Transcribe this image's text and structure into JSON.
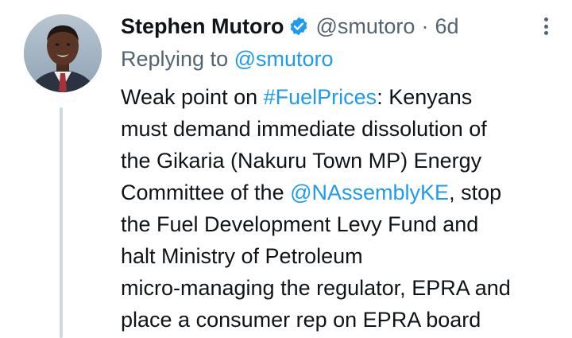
{
  "author": {
    "name": "Stephen Mutoro",
    "handle": "@smutoro",
    "separator": "·",
    "time": "6d",
    "verified": true,
    "avatar_icon": "profile-photo"
  },
  "reply": {
    "prefix": "Replying to",
    "to_handle": "@smutoro"
  },
  "tweet": {
    "lines": [
      {
        "segments": [
          {
            "text": "Weak point on ",
            "link": false
          },
          {
            "text": "#FuelPrices",
            "link": true
          },
          {
            "text": ": Kenyans",
            "link": false
          }
        ]
      },
      {
        "segments": [
          {
            "text": "must demand immediate dissolution of",
            "link": false
          }
        ]
      },
      {
        "segments": [
          {
            "text": "the Gikaria (Nakuru Town MP) Energy",
            "link": false
          }
        ]
      },
      {
        "segments": [
          {
            "text": "Committee of the ",
            "link": false
          },
          {
            "text": "@NAssemblyKE",
            "link": true
          },
          {
            "text": ", stop",
            "link": false
          }
        ]
      },
      {
        "segments": [
          {
            "text": "the Fuel Development Levy Fund and",
            "link": false
          }
        ]
      },
      {
        "segments": [
          {
            "text": "halt Ministry of Petroleum",
            "link": false
          }
        ]
      },
      {
        "segments": [
          {
            "text": "micro-managing the regulator, EPRA and",
            "link": false
          }
        ]
      },
      {
        "segments": [
          {
            "text": "place a consumer rep on EPRA board",
            "link": false
          }
        ]
      }
    ]
  },
  "colors": {
    "link": "#1d9bf0",
    "secondary_text": "#536471",
    "primary_text": "#0f1419",
    "thread_line": "#cfd9de",
    "verified_badge": "#1d9bf0"
  },
  "icons": {
    "verified": "verified-badge-icon",
    "more": "more-options-icon"
  }
}
